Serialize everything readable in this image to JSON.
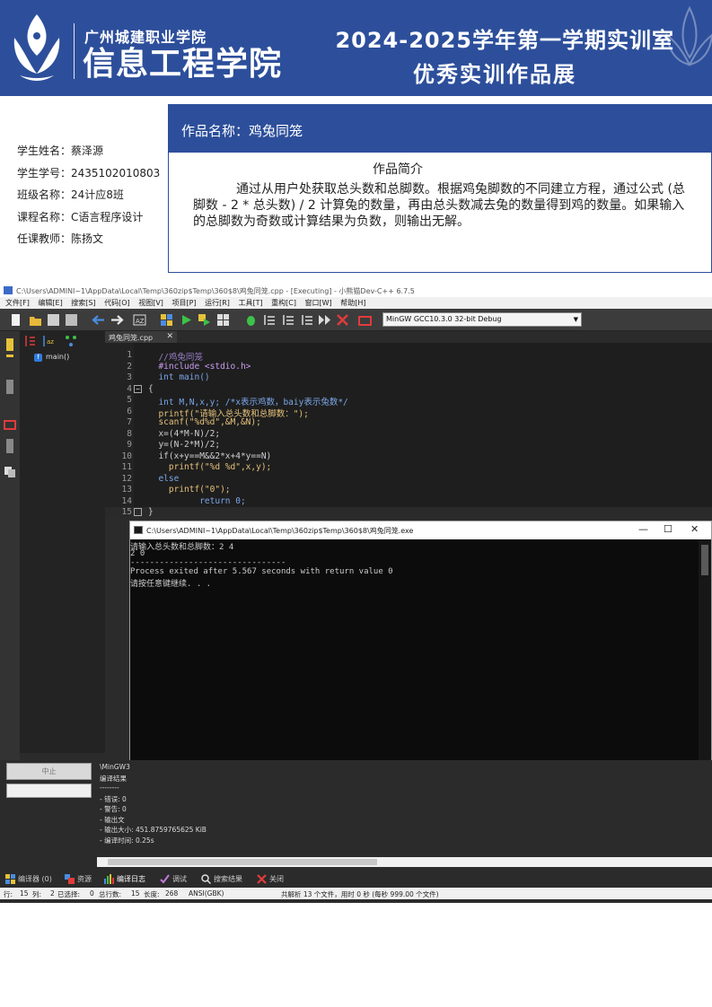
{
  "banner": {
    "school_small": "广州城建职业学院",
    "school_big": "信息工程学院",
    "title_line1": "2024-2025学年第一学期实训室",
    "title_line2": "优秀实训作品展"
  },
  "student": {
    "name": "学生姓名：蔡泽源",
    "id": "学生学号：2435102010803",
    "class": "班级名称：24计应8班",
    "course": "课程名称：C语言程序设计",
    "teacher": "任课教师：陈扬文"
  },
  "work": {
    "title": "作品名称：鸡兔同笼",
    "intro_heading": "作品简介",
    "intro_text": "通过从用户处获取总头数和总脚数。根据鸡兔脚数的不同建立方程，通过公式 (总脚数 - 2 * 总头数) / 2 计算兔的数量，再由总头数减去兔的数量得到鸡的数量。如果输入的总脚数为奇数或计算结果为负数，则输出无解。"
  },
  "ide": {
    "window_title": "C:\\Users\\ADMINI~1\\AppData\\Local\\Temp\\360zip$Temp\\360$8\\鸡兔同笼.cpp - [Executing] - 小熊猫Dev-C++ 6.7.5",
    "menu": [
      "文件[F]",
      "编辑[E]",
      "搜索[S]",
      "代码[O]",
      "视图[V]",
      "项目[P]",
      "运行[R]",
      "工具[T]",
      "重构[C]",
      "窗口[W]",
      "帮助[H]"
    ],
    "compiler": "MinGW GCC10.3.0 32-bit Debug",
    "class_browser_item": "main()",
    "editor_tab": "鸡兔同笼.cpp",
    "code_lines": [
      {
        "n": "1",
        "text": "  //鸡兔同笼",
        "cls": "c-comment"
      },
      {
        "n": "2",
        "text": "  #include <stdio.h>",
        "cls": "c-pre"
      },
      {
        "n": "3",
        "text": "  int main()",
        "cls": "c-kw"
      },
      {
        "n": "4",
        "text": "{",
        "cls": "c-plain"
      },
      {
        "n": "5",
        "text": "  int M,N,x,y; /*x表示鸡数，baiy表示兔数*/",
        "cls": "c-kw"
      },
      {
        "n": "6",
        "text": "  printf(\"请输入总头数和总脚数：\");",
        "cls": "c-str"
      },
      {
        "n": "7",
        "text": "  scanf(\"%d%d\",&M,&N);",
        "cls": "c-str"
      },
      {
        "n": "8",
        "text": "  x=(4*M-N)/2;",
        "cls": "c-plain"
      },
      {
        "n": "9",
        "text": "  y=(N-2*M)/2;",
        "cls": "c-plain"
      },
      {
        "n": "10",
        "text": "  if(x+y==M&&2*x+4*y==N)",
        "cls": "c-plain"
      },
      {
        "n": "11",
        "text": "    printf(\"%d %d\",x,y);",
        "cls": "c-str"
      },
      {
        "n": "12",
        "text": "  else",
        "cls": "c-kw"
      },
      {
        "n": "13",
        "text": "    printf(\"0\");",
        "cls": "c-str"
      },
      {
        "n": "14",
        "text": "          return 0;",
        "cls": "c-kw"
      },
      {
        "n": "15",
        "text": "}",
        "cls": "c-plain"
      }
    ],
    "console_title": "C:\\Users\\ADMINI~1\\AppData\\Local\\Temp\\360zip$Temp\\360$8\\鸡兔同笼.exe",
    "console_lines": [
      "请输入总头数和总脚数：2 4",
      "2 0",
      "--------------------------------",
      "Process exited after 5.567 seconds with return value 0",
      "请按任意键继续. . ."
    ],
    "stop_button": "中止",
    "log_lines": [
      "\\MinGW3",
      "编译结果",
      "--------",
      "- 错误: 0",
      "- 警告: 0",
      "- 输出文",
      "- 输出大小: 451.8759765625 KiB",
      "- 编译时间: 0.25s"
    ],
    "bottom_tabs": [
      "编译器 (0)",
      "资源",
      "编译日志",
      "调试",
      "搜索结果",
      "关闭"
    ],
    "status": {
      "row": "行:",
      "row_val": "15",
      "col": "列:",
      "col_val": "2",
      "selected": "已选择:",
      "selected_val": "0",
      "total_lines": "总行数:",
      "total_lines_val": "15",
      "length": "长度:",
      "length_val": "268",
      "encoding": "ANSI(GBK)",
      "parse": "共解析 13 个文件，用时 0 秒 (每秒 999.00 个文件)"
    }
  },
  "colors": {
    "banner_blue": "#2d4f9b",
    "ide_dark": "#2b2b2b",
    "console_bg": "#0c0c0c"
  }
}
